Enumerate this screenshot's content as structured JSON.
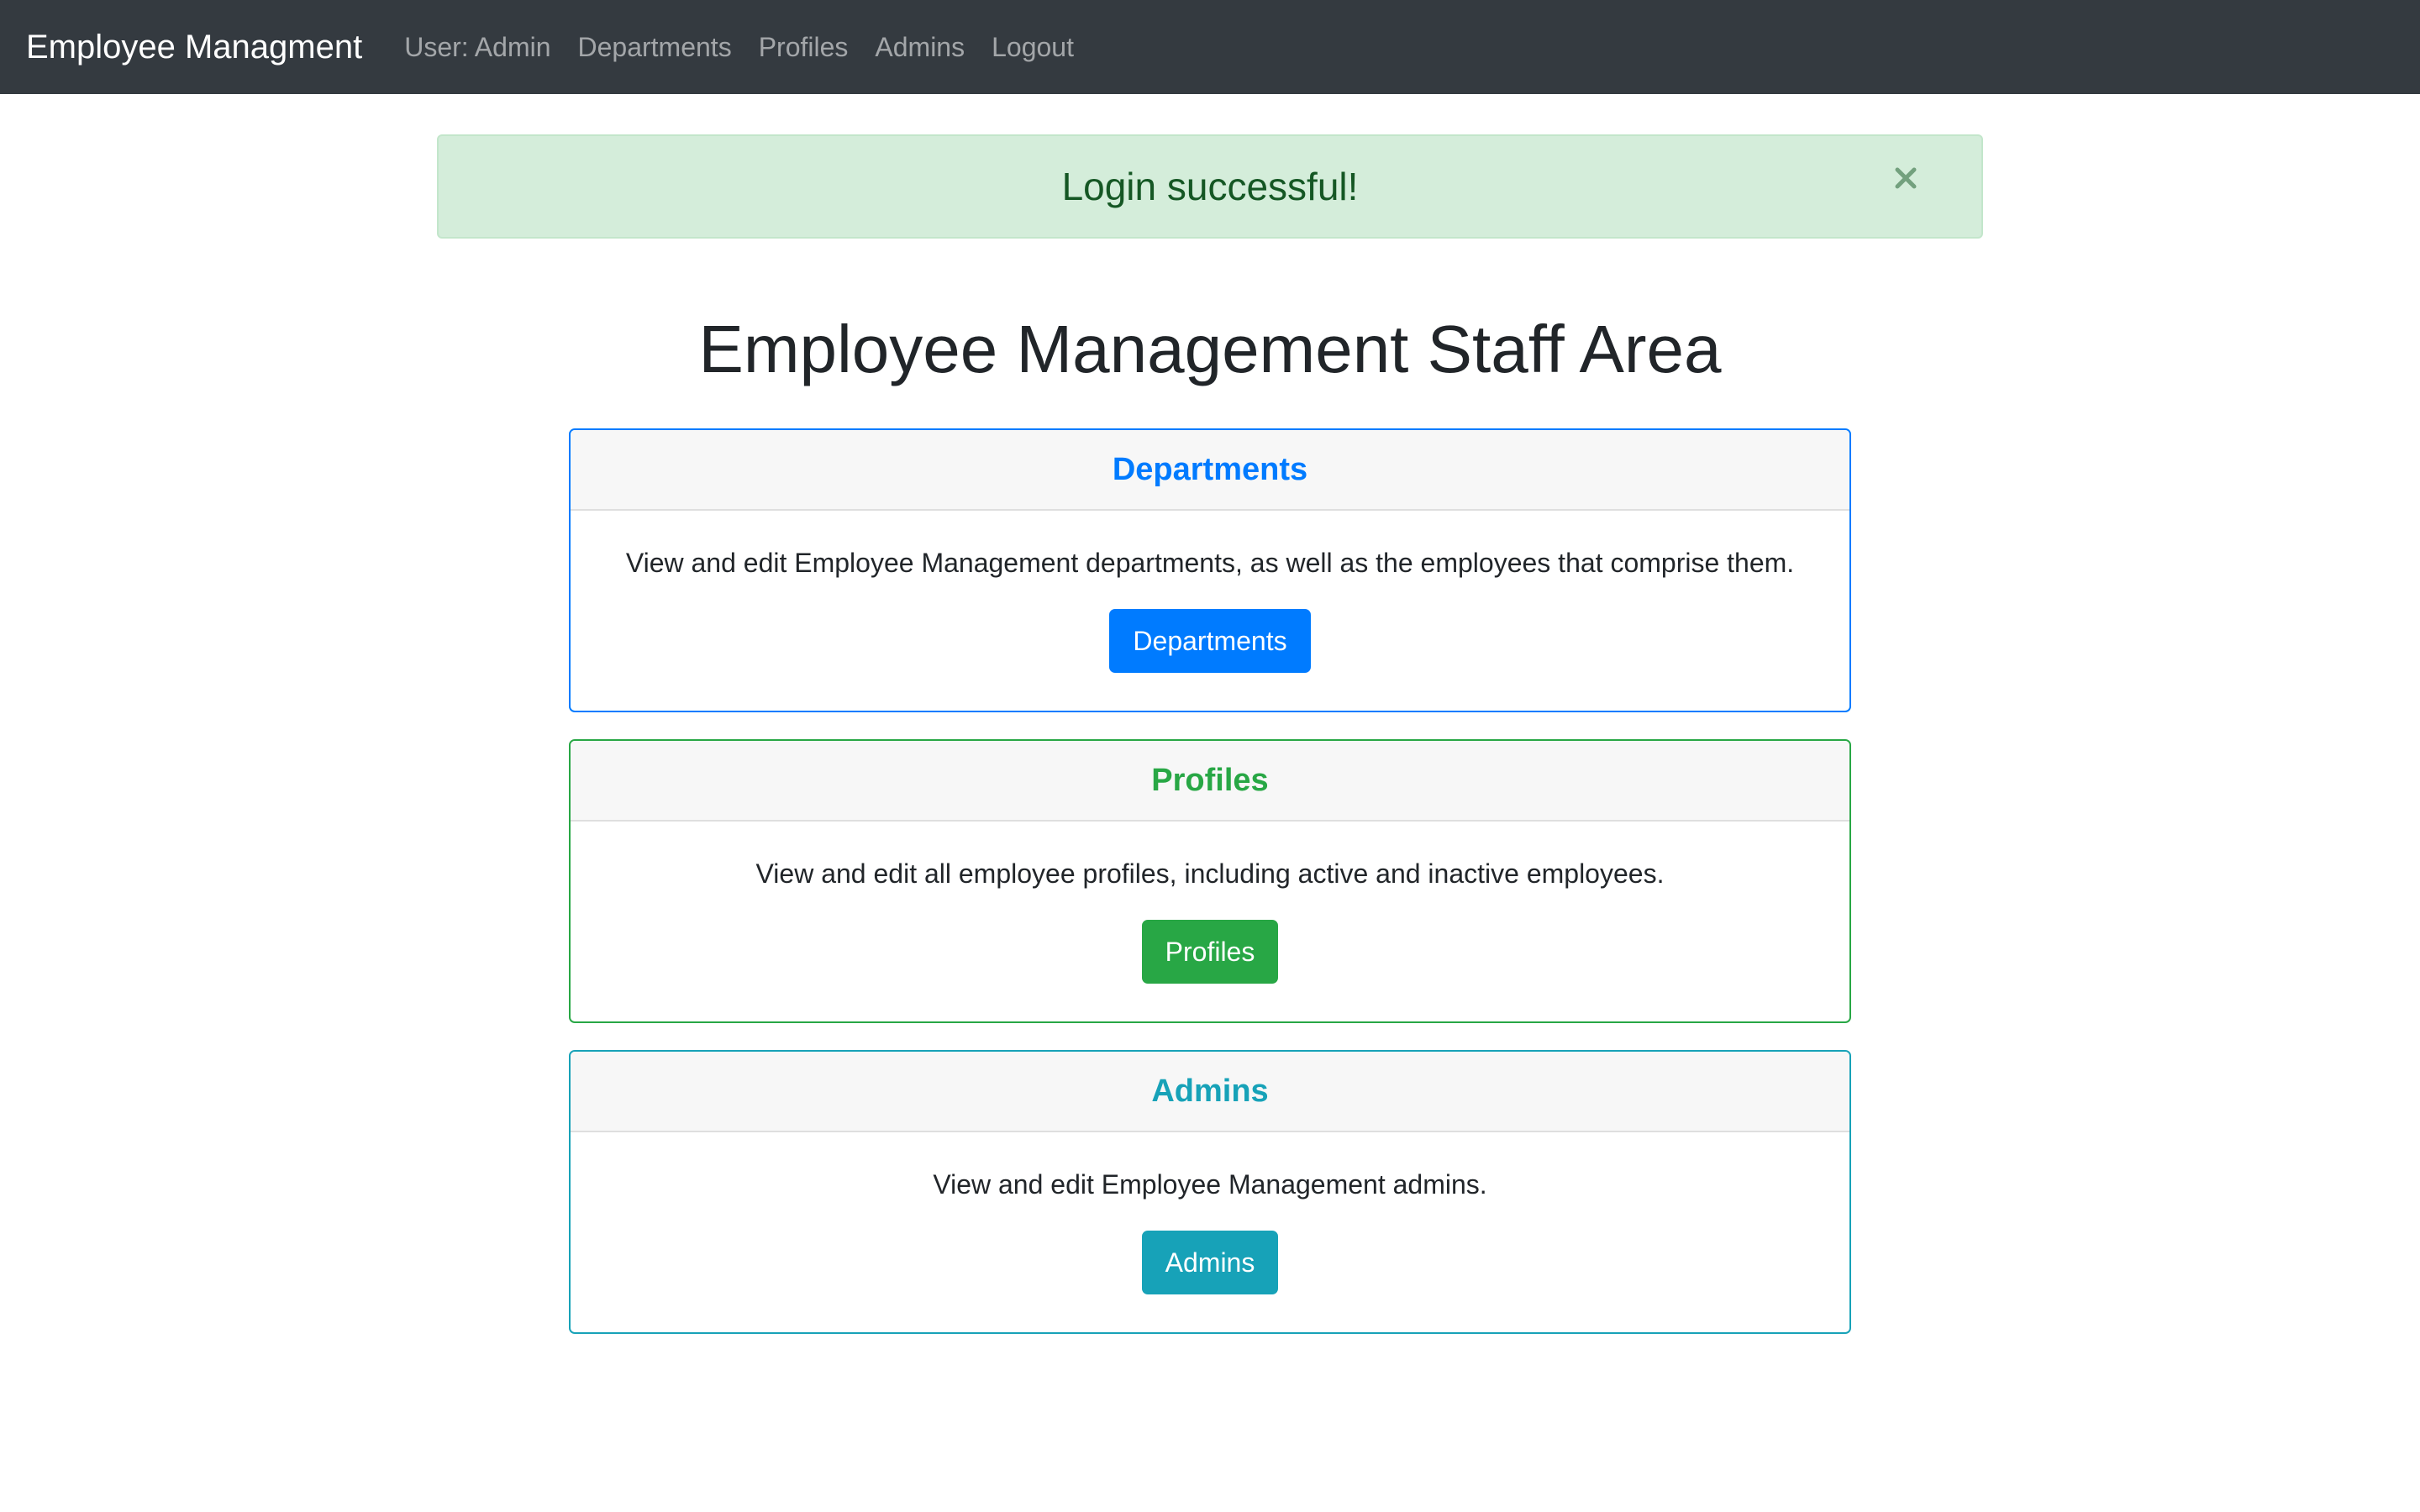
{
  "navbar": {
    "brand": "Employee Managment",
    "user_label": "User: Admin",
    "links": [
      "Departments",
      "Profiles",
      "Admins",
      "Logout"
    ]
  },
  "alert": {
    "message": "Login successful!",
    "close_icon": "close-icon"
  },
  "page_title": "Employee Management Staff Area",
  "cards": [
    {
      "title": "Departments",
      "description": "View and edit Employee Management departments, as well as the employees that comprise them.",
      "button_label": "Departments",
      "color": "#007bff"
    },
    {
      "title": "Profiles",
      "description": "View and edit all employee profiles, including active and inactive employees.",
      "button_label": "Profiles",
      "color": "#28a745"
    },
    {
      "title": "Admins",
      "description": "View and edit Employee Management admins.",
      "button_label": "Admins",
      "color": "#17a2b8"
    }
  ],
  "colors": {
    "navbar_bg": "#343a40",
    "alert_bg": "#d4edda",
    "alert_text": "#155724"
  }
}
